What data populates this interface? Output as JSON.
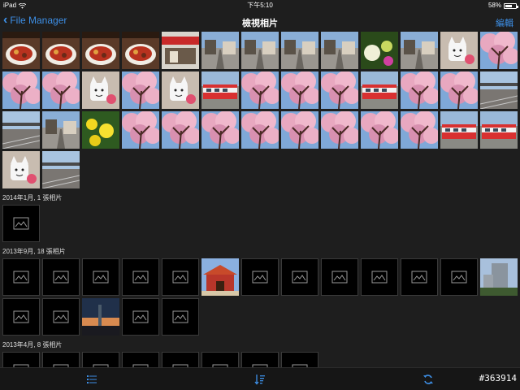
{
  "status_bar": {
    "device": "iPad",
    "time": "下午5:10",
    "battery": "58%",
    "battery_level": 0.58
  },
  "nav": {
    "back_label": "File Manager",
    "title": "檢視相片",
    "edit_label": "編輯"
  },
  "top_photos": [
    {
      "icon": "photo-food"
    },
    {
      "icon": "photo-food"
    },
    {
      "icon": "photo-food"
    },
    {
      "icon": "photo-food"
    },
    {
      "icon": "photo-shop"
    },
    {
      "icon": "photo-street"
    },
    {
      "icon": "photo-street"
    },
    {
      "icon": "photo-street"
    },
    {
      "icon": "photo-street"
    },
    {
      "icon": "photo-flowers"
    },
    {
      "icon": "photo-street"
    },
    {
      "icon": "photo-mascot"
    },
    {
      "icon": "photo-blossom"
    },
    {
      "icon": "photo-blossom"
    },
    {
      "icon": "photo-blossom"
    },
    {
      "icon": "photo-mascot"
    },
    {
      "icon": "photo-blossom"
    },
    {
      "icon": "photo-mascot"
    },
    {
      "icon": "photo-train"
    },
    {
      "icon": "photo-blossom"
    },
    {
      "icon": "photo-blossom"
    },
    {
      "icon": "photo-blossom"
    },
    {
      "icon": "photo-train"
    },
    {
      "icon": "photo-blossom"
    },
    {
      "icon": "photo-blossom"
    },
    {
      "icon": "photo-station"
    },
    {
      "icon": "photo-station"
    },
    {
      "icon": "photo-street"
    },
    {
      "icon": "photo-rapeseed"
    },
    {
      "icon": "photo-blossom"
    },
    {
      "icon": "photo-blossom"
    },
    {
      "icon": "photo-blossom"
    },
    {
      "icon": "photo-blossom"
    },
    {
      "icon": "photo-blossom"
    },
    {
      "icon": "photo-blossom"
    },
    {
      "icon": "photo-blossom"
    },
    {
      "icon": "photo-blossom"
    },
    {
      "icon": "photo-train"
    },
    {
      "icon": "photo-train"
    },
    {
      "icon": "photo-mascot"
    },
    {
      "icon": "photo-station"
    }
  ],
  "sections": [
    {
      "header": "2014年1月, 1 張相片",
      "items": [
        "placeholder"
      ]
    },
    {
      "header": "2013年9月, 18 張相片",
      "items": [
        "placeholder",
        "placeholder",
        "placeholder",
        "placeholder",
        "placeholder",
        "photo-temple",
        "placeholder",
        "placeholder",
        "placeholder",
        "placeholder",
        "placeholder",
        "placeholder",
        "photo-building",
        "placeholder",
        "placeholder",
        "photo-night-city",
        "placeholder",
        "placeholder"
      ]
    },
    {
      "header": "2013年4月, 8 張相片",
      "items": [
        "placeholder",
        "placeholder",
        "placeholder",
        "placeholder",
        "placeholder",
        "placeholder",
        "placeholder",
        "placeholder"
      ]
    }
  ],
  "tab_bar": {
    "list_icon": "list-icon",
    "sort_icon": "sort-icon",
    "refresh_icon": "refresh-icon"
  },
  "watermark": "#363914",
  "colors": {
    "accent": "#3d8fe6",
    "background": "#1e1e1e"
  }
}
